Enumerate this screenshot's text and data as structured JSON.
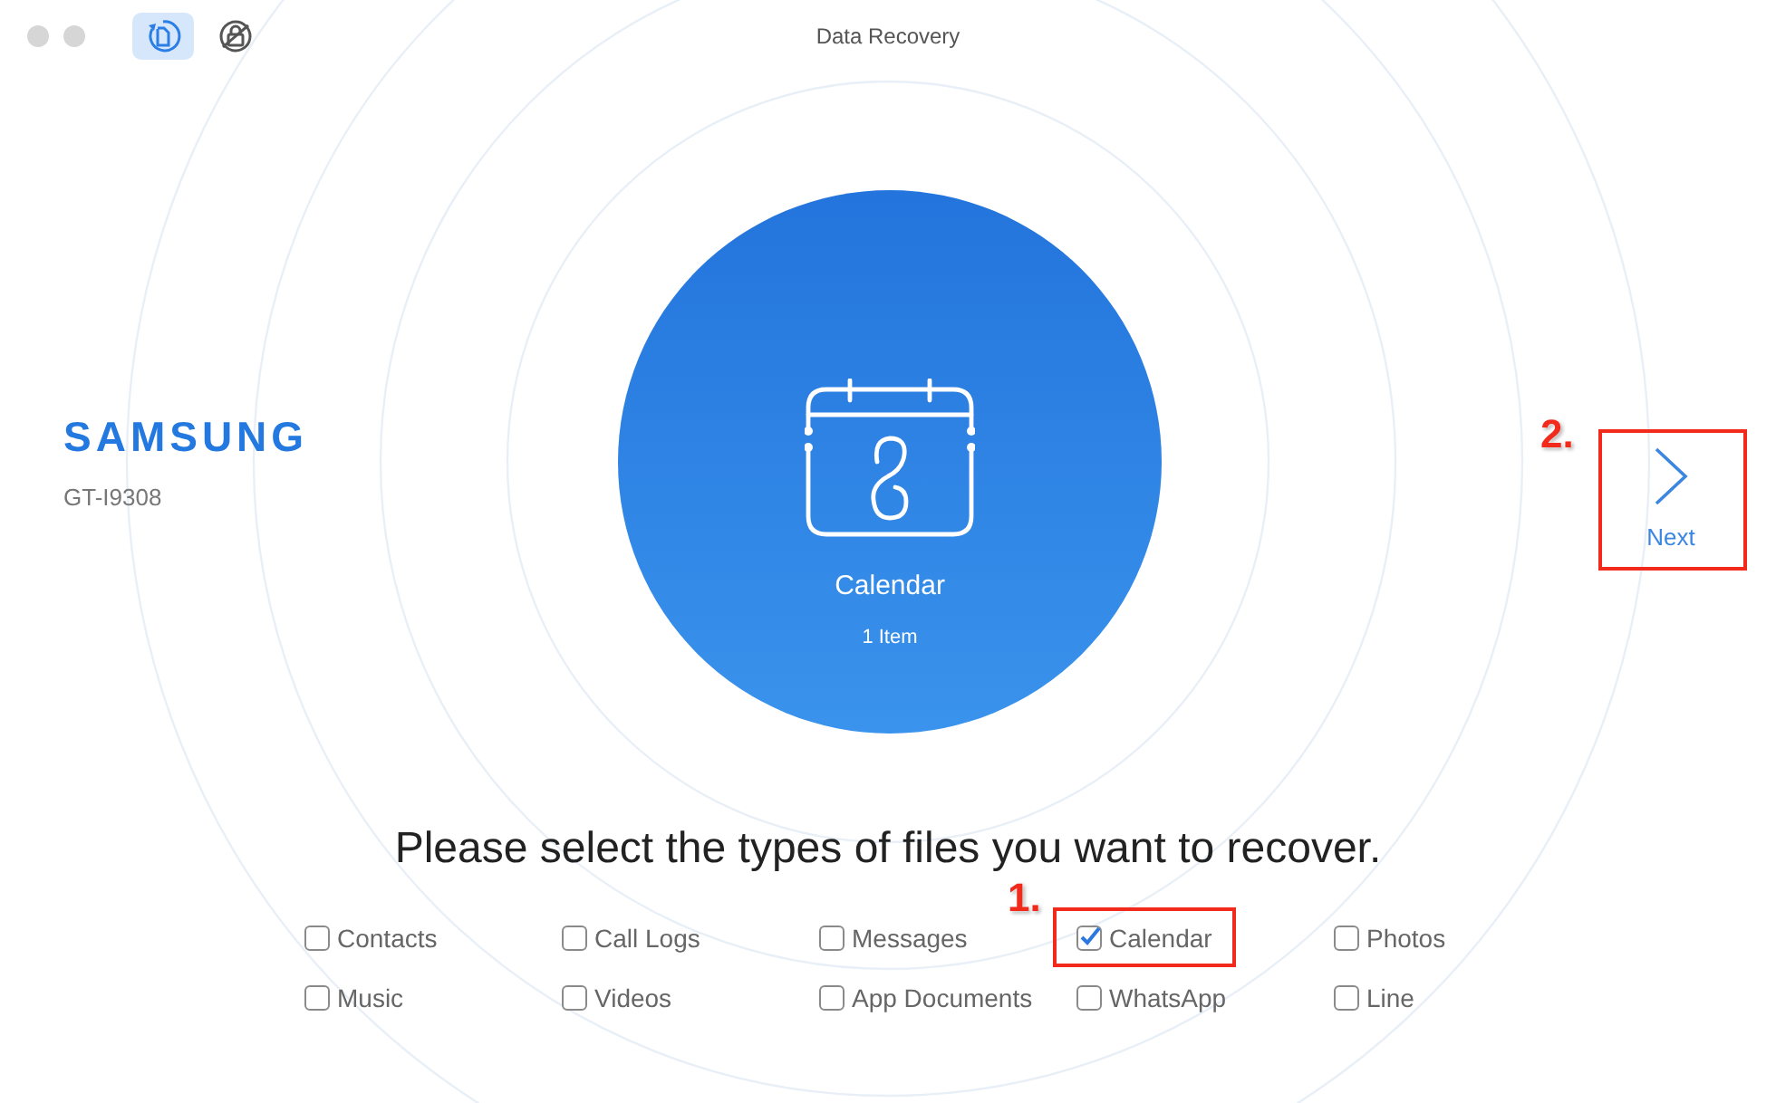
{
  "window": {
    "title": "Data Recovery"
  },
  "toolbar": [
    {
      "kind": "recover",
      "selected": true
    },
    {
      "kind": "lock",
      "selected": false
    }
  ],
  "device": {
    "brand": "SAMSUNG",
    "model": "GT-I9308"
  },
  "preview": {
    "title": "Calendar",
    "count": "1 Item"
  },
  "next": {
    "label": "Next",
    "highlighted": true,
    "callout": "2."
  },
  "prompt": "Please select the types of files you want to recover.",
  "file_types": [
    {
      "label": "Contacts",
      "checked": false,
      "highlighted": false
    },
    {
      "label": "Call Logs",
      "checked": false,
      "highlighted": false
    },
    {
      "label": "Messages",
      "checked": false,
      "highlighted": false
    },
    {
      "label": "Calendar",
      "checked": true,
      "highlighted": true,
      "callout": "1."
    },
    {
      "label": "Photos",
      "checked": false,
      "highlighted": false
    },
    {
      "label": "Music",
      "checked": false,
      "highlighted": false
    },
    {
      "label": "Videos",
      "checked": false,
      "highlighted": false
    },
    {
      "label": "App Documents",
      "checked": false,
      "highlighted": false
    },
    {
      "label": "WhatsApp",
      "checked": false,
      "highlighted": false
    },
    {
      "label": "Line",
      "checked": false,
      "highlighted": false
    }
  ]
}
